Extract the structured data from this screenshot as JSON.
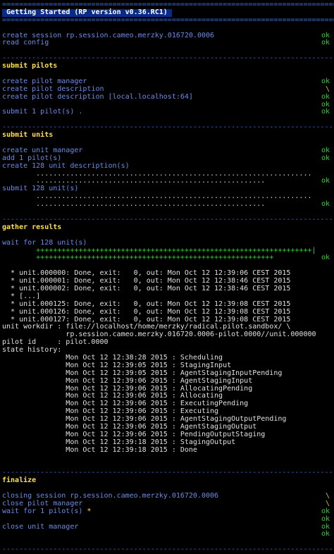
{
  "colors": {
    "background": "#000000",
    "separator": "#3d6bd8",
    "header": "#ffe04a",
    "action": "#6b8ce8",
    "ok": "#2fd12f",
    "text": "#e0e0e0"
  },
  "separator_line": "================================================================================",
  "dash_line": "--------------------------------------------------------------------------------",
  "title": "Getting Started (RP version v0.36.RC1)",
  "getting_started": {
    "lines": [
      {
        "text": "create session rp.session.cameo.merzky.016720.0006",
        "status": "ok"
      },
      {
        "text": "read config",
        "status": "ok"
      }
    ]
  },
  "submit_pilots": {
    "header": "submit pilots",
    "lines": [
      {
        "text": "create pilot manager",
        "status": "ok"
      },
      {
        "text": "create pilot description",
        "status": "\\"
      },
      {
        "text": "create pilot description [local.localhost:64]",
        "status": "ok"
      },
      {
        "text": "",
        "status": "ok"
      },
      {
        "text": "submit 1 pilot(s) .",
        "status": "ok"
      }
    ]
  },
  "submit_units": {
    "header": "submit units",
    "lines": [
      {
        "text": "create unit manager",
        "status": "ok"
      },
      {
        "text": "add 1 pilot(s)",
        "status": "ok"
      },
      {
        "text": "create 128 unit description(s)",
        "status": ""
      },
      {
        "text": "        .................................................................",
        "status": ""
      },
      {
        "text": "        ......................................................",
        "status": "ok"
      },
      {
        "text": "submit 128 unit(s)",
        "status": ""
      },
      {
        "text": "        .................................................................",
        "status": ""
      },
      {
        "text": "        ......................................................",
        "status": "ok"
      }
    ]
  },
  "gather_results": {
    "header": "gather results",
    "wait_line": "wait for 128 unit(s)",
    "progress": [
      {
        "text": "        +++++++++++++++++++++++++++++++++++++++++++++++++++++++++++++++++|",
        "status": ""
      },
      {
        "text": "        ++++++++++++++++++++++++++++++++++++++++++++++++++++++++",
        "status": "ok"
      }
    ],
    "units": [
      "  * unit.000000: Done, exit:   0, out: Mon Oct 12 12:39:06 CEST 2015",
      "  * unit.000001: Done, exit:   0, out: Mon Oct 12 12:38:46 CEST 2015",
      "  * unit.000002: Done, exit:   0, out: Mon Oct 12 12:38:46 CEST 2015",
      "  * [...]",
      "  * unit.000125: Done, exit:   0, out: Mon Oct 12 12:39:08 CEST 2015",
      "  * unit.000126: Done, exit:   0, out: Mon Oct 12 12:39:08 CEST 2015",
      "  * unit.000127: Done, exit:   0, out: Mon Oct 12 12:39:08 CEST 2015"
    ],
    "workdir_line1": "unit workdir : file://localhost/home/merzky/radical.pilot.sandbox/ \\",
    "workdir_line2": "               rp.session.cameo.merzky.016720.0006-pilot.0000//unit.000000",
    "pilot_id_line": "pilot id     : pilot.0000",
    "state_history_label": "state history:",
    "state_history": [
      "               Mon Oct 12 12:38:28 2015 : Scheduling",
      "               Mon Oct 12 12:39:05 2015 : StagingInput",
      "               Mon Oct 12 12:39:05 2015 : AgentStagingInputPending",
      "               Mon Oct 12 12:39:06 2015 : AgentStagingInput",
      "               Mon Oct 12 12:39:06 2015 : AllocatingPending",
      "               Mon Oct 12 12:39:06 2015 : Allocating",
      "               Mon Oct 12 12:39:06 2015 : ExecutingPending",
      "               Mon Oct 12 12:39:06 2015 : Executing",
      "               Mon Oct 12 12:39:06 2015 : AgentStagingOutputPending",
      "               Mon Oct 12 12:39:06 2015 : AgentStagingOutput",
      "               Mon Oct 12 12:39:06 2015 : PendingOutputStaging",
      "               Mon Oct 12 12:39:18 2015 : StagingOutput",
      "               Mon Oct 12 12:39:18 2015 : Done"
    ]
  },
  "finalize": {
    "header": "finalize",
    "lines": [
      {
        "text": "closing session rp.session.cameo.merzky.016720.0006",
        "status": "\\"
      },
      {
        "text": "close pilot manager",
        "status": "\\"
      },
      {
        "text": "wait for 1 pilot(s) *",
        "status": "ok"
      },
      {
        "text": "",
        "status": "ok"
      },
      {
        "text": "close unit manager",
        "status": "ok"
      },
      {
        "text": "",
        "status": "ok"
      }
    ]
  }
}
